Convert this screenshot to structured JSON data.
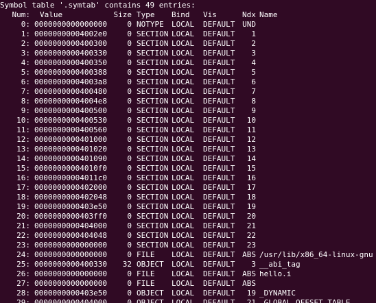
{
  "terminal": {
    "header_line": "Symbol table '.symtab' contains 49 entries:",
    "columns": {
      "num": "Num:",
      "value": "Value",
      "size": "Size",
      "type": "Type",
      "bind": "Bind",
      "vis": "Vis",
      "ndx": "Ndx",
      "name": "Name"
    },
    "rows": [
      {
        "num": "0:",
        "value": "0000000000000000",
        "size": "0",
        "type": "NOTYPE",
        "bind": "LOCAL",
        "vis": "DEFAULT",
        "ndx": "UND",
        "name": ""
      },
      {
        "num": "1:",
        "value": "00000000004002e0",
        "size": "0",
        "type": "SECTION",
        "bind": "LOCAL",
        "vis": "DEFAULT",
        "ndx": "1",
        "name": ""
      },
      {
        "num": "2:",
        "value": "0000000000400300",
        "size": "0",
        "type": "SECTION",
        "bind": "LOCAL",
        "vis": "DEFAULT",
        "ndx": "2",
        "name": ""
      },
      {
        "num": "3:",
        "value": "0000000000400330",
        "size": "0",
        "type": "SECTION",
        "bind": "LOCAL",
        "vis": "DEFAULT",
        "ndx": "3",
        "name": ""
      },
      {
        "num": "4:",
        "value": "0000000000400350",
        "size": "0",
        "type": "SECTION",
        "bind": "LOCAL",
        "vis": "DEFAULT",
        "ndx": "4",
        "name": ""
      },
      {
        "num": "5:",
        "value": "0000000000400388",
        "size": "0",
        "type": "SECTION",
        "bind": "LOCAL",
        "vis": "DEFAULT",
        "ndx": "5",
        "name": ""
      },
      {
        "num": "6:",
        "value": "00000000004003a8",
        "size": "0",
        "type": "SECTION",
        "bind": "LOCAL",
        "vis": "DEFAULT",
        "ndx": "6",
        "name": ""
      },
      {
        "num": "7:",
        "value": "0000000000400480",
        "size": "0",
        "type": "SECTION",
        "bind": "LOCAL",
        "vis": "DEFAULT",
        "ndx": "7",
        "name": ""
      },
      {
        "num": "8:",
        "value": "00000000004004e8",
        "size": "0",
        "type": "SECTION",
        "bind": "LOCAL",
        "vis": "DEFAULT",
        "ndx": "8",
        "name": ""
      },
      {
        "num": "9:",
        "value": "0000000000400500",
        "size": "0",
        "type": "SECTION",
        "bind": "LOCAL",
        "vis": "DEFAULT",
        "ndx": "9",
        "name": ""
      },
      {
        "num": "10:",
        "value": "0000000000400530",
        "size": "0",
        "type": "SECTION",
        "bind": "LOCAL",
        "vis": "DEFAULT",
        "ndx": "10",
        "name": ""
      },
      {
        "num": "11:",
        "value": "0000000000400560",
        "size": "0",
        "type": "SECTION",
        "bind": "LOCAL",
        "vis": "DEFAULT",
        "ndx": "11",
        "name": ""
      },
      {
        "num": "12:",
        "value": "0000000000401000",
        "size": "0",
        "type": "SECTION",
        "bind": "LOCAL",
        "vis": "DEFAULT",
        "ndx": "12",
        "name": ""
      },
      {
        "num": "13:",
        "value": "0000000000401020",
        "size": "0",
        "type": "SECTION",
        "bind": "LOCAL",
        "vis": "DEFAULT",
        "ndx": "13",
        "name": ""
      },
      {
        "num": "14:",
        "value": "0000000000401090",
        "size": "0",
        "type": "SECTION",
        "bind": "LOCAL",
        "vis": "DEFAULT",
        "ndx": "14",
        "name": ""
      },
      {
        "num": "15:",
        "value": "00000000004010f0",
        "size": "0",
        "type": "SECTION",
        "bind": "LOCAL",
        "vis": "DEFAULT",
        "ndx": "15",
        "name": ""
      },
      {
        "num": "16:",
        "value": "00000000004011c0",
        "size": "0",
        "type": "SECTION",
        "bind": "LOCAL",
        "vis": "DEFAULT",
        "ndx": "16",
        "name": ""
      },
      {
        "num": "17:",
        "value": "0000000000402000",
        "size": "0",
        "type": "SECTION",
        "bind": "LOCAL",
        "vis": "DEFAULT",
        "ndx": "17",
        "name": ""
      },
      {
        "num": "18:",
        "value": "0000000000402048",
        "size": "0",
        "type": "SECTION",
        "bind": "LOCAL",
        "vis": "DEFAULT",
        "ndx": "18",
        "name": ""
      },
      {
        "num": "19:",
        "value": "0000000000403e50",
        "size": "0",
        "type": "SECTION",
        "bind": "LOCAL",
        "vis": "DEFAULT",
        "ndx": "19",
        "name": ""
      },
      {
        "num": "20:",
        "value": "0000000000403ff0",
        "size": "0",
        "type": "SECTION",
        "bind": "LOCAL",
        "vis": "DEFAULT",
        "ndx": "20",
        "name": ""
      },
      {
        "num": "21:",
        "value": "0000000000404000",
        "size": "0",
        "type": "SECTION",
        "bind": "LOCAL",
        "vis": "DEFAULT",
        "ndx": "21",
        "name": ""
      },
      {
        "num": "22:",
        "value": "0000000000404048",
        "size": "0",
        "type": "SECTION",
        "bind": "LOCAL",
        "vis": "DEFAULT",
        "ndx": "22",
        "name": ""
      },
      {
        "num": "23:",
        "value": "0000000000000000",
        "size": "0",
        "type": "SECTION",
        "bind": "LOCAL",
        "vis": "DEFAULT",
        "ndx": "23",
        "name": ""
      },
      {
        "num": "24:",
        "value": "0000000000000000",
        "size": "0",
        "type": "FILE",
        "bind": "LOCAL",
        "vis": "DEFAULT",
        "ndx": "ABS",
        "name": "/usr/lib/x86_64-linux-gnu"
      },
      {
        "num": "25:",
        "value": "0000000000400330",
        "size": "32",
        "type": "OBJECT",
        "bind": "LOCAL",
        "vis": "DEFAULT",
        "ndx": "3",
        "name": "__abi_tag"
      },
      {
        "num": "26:",
        "value": "0000000000000000",
        "size": "0",
        "type": "FILE",
        "bind": "LOCAL",
        "vis": "DEFAULT",
        "ndx": "ABS",
        "name": "hello.i"
      },
      {
        "num": "27:",
        "value": "0000000000000000",
        "size": "0",
        "type": "FILE",
        "bind": "LOCAL",
        "vis": "DEFAULT",
        "ndx": "ABS",
        "name": ""
      },
      {
        "num": "28:",
        "value": "0000000000403e50",
        "size": "0",
        "type": "OBJECT",
        "bind": "LOCAL",
        "vis": "DEFAULT",
        "ndx": "19",
        "name": "_DYNAMIC"
      },
      {
        "num": "29:",
        "value": "0000000000404000",
        "size": "0",
        "type": "OBJECT",
        "bind": "LOCAL",
        "vis": "DEFAULT",
        "ndx": "21",
        "name": "_GLOBAL_OFFSET_TABLE_"
      }
    ]
  },
  "colors": {
    "background": "#300a24",
    "text": "#ffffff"
  }
}
